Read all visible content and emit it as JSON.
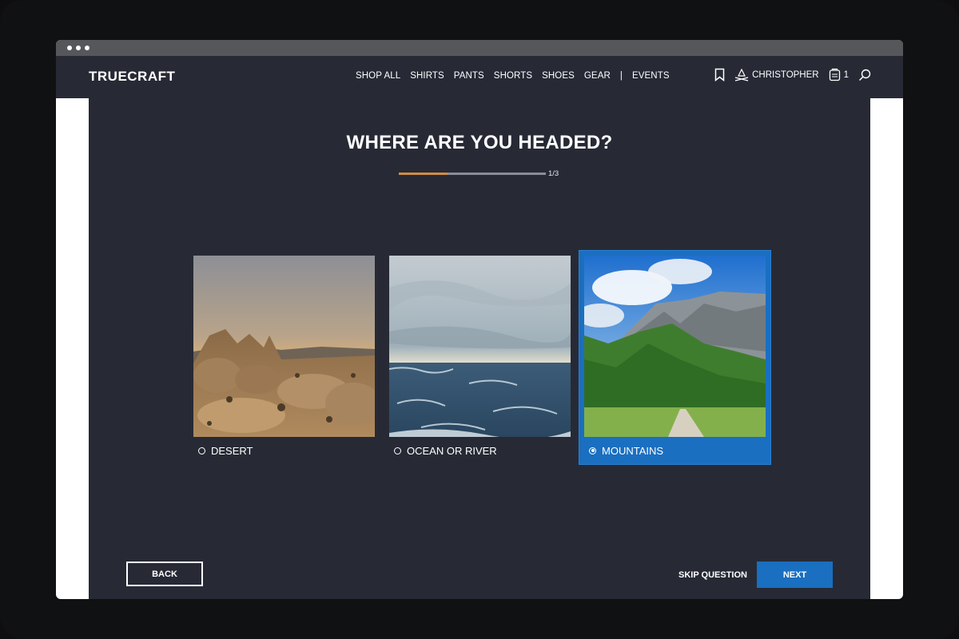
{
  "header": {
    "logo": "TRUECRAFT",
    "nav": [
      "SHOP ALL",
      "SHIRTS",
      "PANTS",
      "SHORTS",
      "SHOES",
      "GEAR",
      "|",
      "EVENTS"
    ],
    "user_name": "CHRISTOPHER",
    "cart_count": "1",
    "icons": [
      "bookmark-icon",
      "campfire-icon",
      "cart-icon",
      "search-icon"
    ]
  },
  "quiz": {
    "title": "WHERE ARE YOU HEADED?",
    "progress_label": "1/3",
    "progress_fraction": 0.333,
    "options": [
      {
        "label": "DESERT",
        "selected": false
      },
      {
        "label": "OCEAN OR RIVER",
        "selected": false
      },
      {
        "label": "MOUNTAINS",
        "selected": true
      }
    ]
  },
  "footer": {
    "back_label": "BACK",
    "skip_label": "SKIP QUESTION",
    "next_label": "NEXT"
  },
  "colors": {
    "page_bg": "#272a35",
    "accent_blue": "#1a6fc0",
    "progress_orange": "#d08a45"
  }
}
